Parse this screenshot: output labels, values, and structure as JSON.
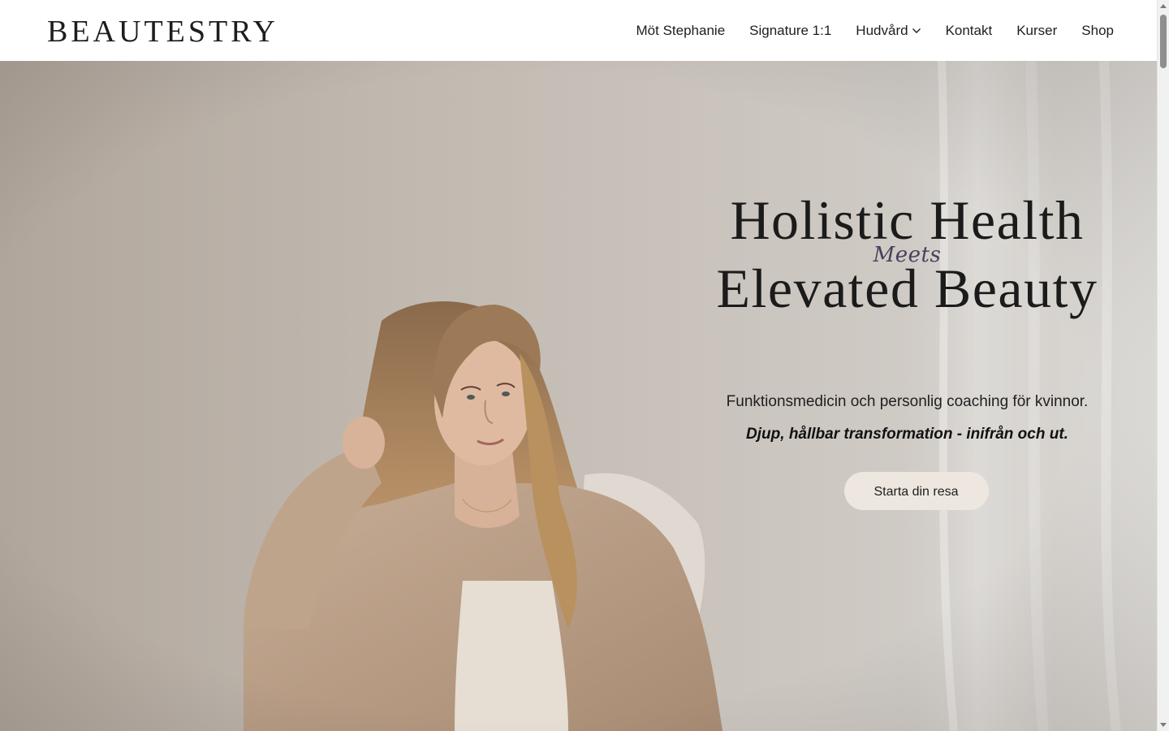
{
  "header": {
    "logo": "BEAUTESTRY",
    "nav": [
      {
        "label": "Möt Stephanie"
      },
      {
        "label": "Signature 1:1"
      },
      {
        "label": "Hudvård",
        "has_dropdown": true
      },
      {
        "label": "Kontakt"
      },
      {
        "label": "Kurser"
      },
      {
        "label": "Shop"
      }
    ]
  },
  "hero": {
    "headline_line1": "Holistic Health",
    "headline_meets": "Meets",
    "headline_line2": "Elevated Beauty",
    "subtitle": "Funktionsmedicin och personlig coaching för kvinnor.",
    "tagline": "Djup, hållbar transformation - inifrån och ut.",
    "cta_label": "Starta din resa",
    "photo_subject": "portrait-woman-beige-blazer"
  },
  "colors": {
    "header_bg": "#ffffff",
    "hero_bg": "#c6bfb7",
    "cta_bg": "#ede7df",
    "accent_meets": "#4a3f5c",
    "text": "#1b1b1b"
  }
}
